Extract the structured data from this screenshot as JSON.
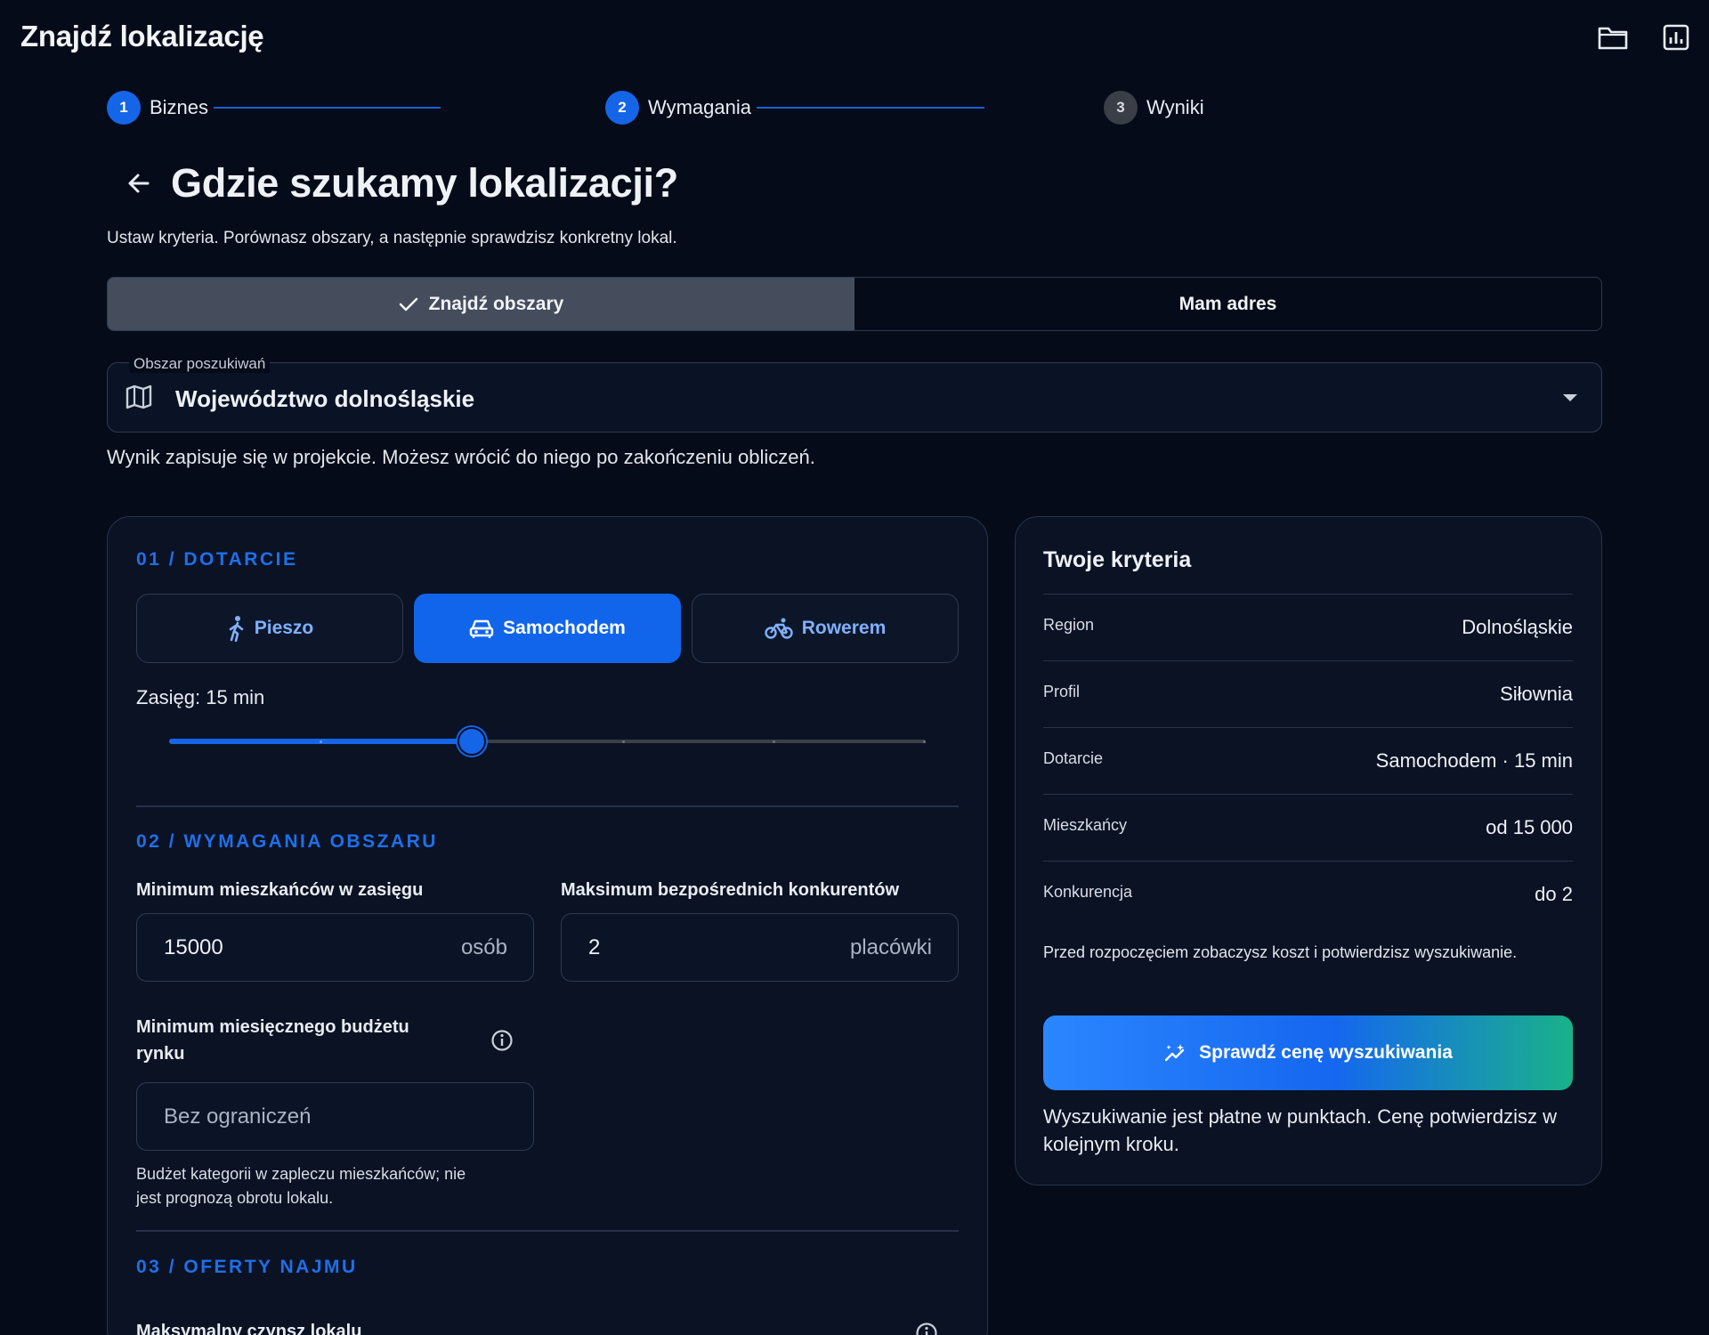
{
  "app": {
    "title": "Znajdź lokalizację",
    "icons": [
      "folder-icon",
      "report-icon"
    ]
  },
  "stepper": {
    "steps": [
      {
        "number": "1",
        "label": "Biznes",
        "state": "completed"
      },
      {
        "number": "2",
        "label": "Wymagania",
        "state": "active"
      },
      {
        "number": "3",
        "label": "Wyniki",
        "state": "upcoming"
      }
    ]
  },
  "header": {
    "title": "Gdzie szukamy lokalizacji?",
    "subtitle": "Ustaw kryteria. Porównasz obszary, a następnie sprawdzisz konkretny lokal."
  },
  "mode_toggle": {
    "options": [
      "Znajdź obszary",
      "Mam adres"
    ],
    "selected": "Znajdź obszary"
  },
  "search_area": {
    "legend": "Obszar poszukiwań",
    "value": "Województwo dolnośląskie",
    "note": "Wynik zapisuje się w projekcie. Możesz wrócić do niego po zakończeniu obliczeń."
  },
  "section_access": {
    "heading": "01 / DOTARCIE",
    "modes": [
      "Pieszo",
      "Samochodem",
      "Rowerem"
    ],
    "selected_mode": "Samochodem",
    "range_label": "Zasięg: 15 min",
    "slider": {
      "min": 0,
      "max": 5,
      "value": 2
    }
  },
  "section_requirements": {
    "heading": "02 / WYMAGANIA OBSZARU",
    "min_residents": {
      "label": "Minimum mieszkańców w zasięgu",
      "value": "15000",
      "unit": "osób"
    },
    "max_competitors": {
      "label": "Maksimum bezpośrednich konkurentów",
      "value": "2",
      "unit": "placówki"
    },
    "min_budget": {
      "label_line1": "Minimum miesięcznego budżetu",
      "label_line2": "rynku",
      "placeholder": "Bez ograniczeń",
      "help_line1": "Budżet kategorii w zapleczu mieszkańców; nie",
      "help_line2": "jest prognozą obrotu lokalu."
    }
  },
  "section_offers": {
    "heading": "03 / OFERTY NAJMU",
    "max_rent_label": "Maksymalny czynsz lokalu"
  },
  "criteria_card": {
    "title": "Twoje kryteria",
    "rows": [
      {
        "key": "Region",
        "value": "Dolnośląskie"
      },
      {
        "key": "Profil",
        "value": "Siłownia"
      },
      {
        "key": "Dotarcie",
        "value": "Samochodem · 15 min"
      },
      {
        "key": "Mieszkańcy",
        "value": "od 15 000"
      },
      {
        "key": "Konkurencja",
        "value": "do 2"
      }
    ],
    "info": "Przed rozpoczęciem zobaczysz koszt i potwierdzisz wyszukiwanie.",
    "cta_label": "Sprawdź cenę wyszukiwania",
    "footnote_line1": "Wyszukiwanie jest płatne w punktach. Cenę potwierdzisz w",
    "footnote_line2": "kolejnym kroku."
  },
  "colors": {
    "background": "#050b18",
    "accent": "#1165eb",
    "section_heading": "#1f6fe8",
    "cta_gradient_end": "#19b28a"
  }
}
